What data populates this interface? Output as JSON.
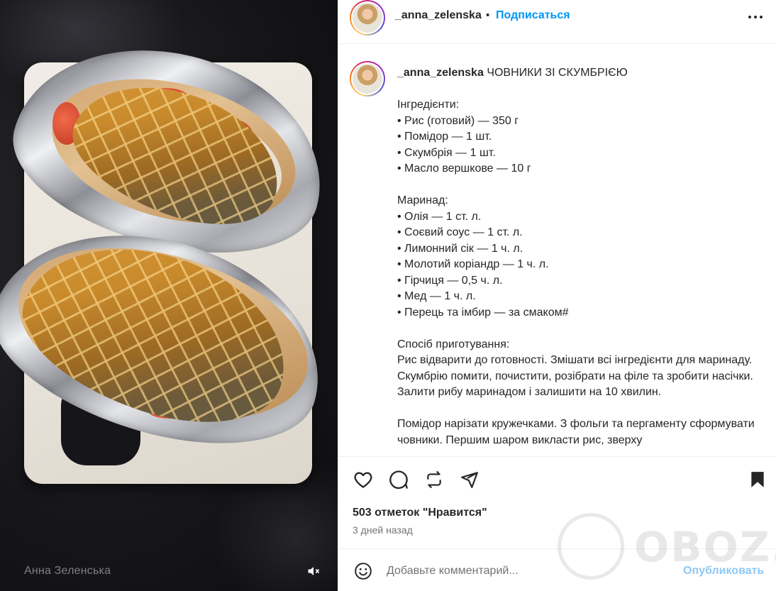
{
  "media": {
    "watermark_name": "Анна Зеленська",
    "mute_icon": "speaker-muted-icon"
  },
  "header": {
    "username": "_anna_zelenska",
    "separator": "•",
    "follow_label": "Подписаться",
    "more_icon": "more-horizontal-icon"
  },
  "caption": {
    "author": "_anna_zelenska",
    "title": "ЧОВНИКИ ЗІ СКУМБРІЄЮ",
    "ingredients_heading": "Інгредієнти:",
    "ingredients": [
      "• Рис (готовий) — 350 г",
      "• Помідор — 1 шт.",
      "• Скумбрія — 1 шт.",
      "• Масло вершкове — 10 г"
    ],
    "marinade_heading": "Маринад:",
    "marinade": [
      "• Олія — 1 ст. л.",
      "• Соєвий соус — 1 ст. л.",
      "• Лимонний сік — 1 ч. л.",
      "• Молотий коріандр — 1 ч. л.",
      "• Гірчиця — 0,5 ч. л.",
      "• Мед — 1 ч. л.",
      "• Перець та імбир — за смаком#"
    ],
    "method_heading": "Спосіб приготування:",
    "method_p1": "Рис відварити до готовності. Змішати всі інгредієнти для маринаду. Скумбрію помити, почистити, розібрати на філе та зробити насічки. Залити рибу маринадом і залишити на 10 хвилин.",
    "method_p2": "Помідор нарізати кружечками. З фольги та пергаменту сформувати човники. Першим шаром викласти рис, зверху"
  },
  "actions": {
    "like_icon": "heart-icon",
    "comment_icon": "comment-icon",
    "repost_icon": "repost-icon",
    "share_icon": "send-icon",
    "save_icon": "bookmark-icon"
  },
  "likes_text": "503 отметок \"Нравится\"",
  "date_text": "3 дней назад",
  "comment": {
    "placeholder": "Добавьте комментарий...",
    "post_label": "Опубликовать",
    "emoji_icon": "emoji-icon"
  },
  "watermark": {
    "text": "OBOZ.UA"
  },
  "colors": {
    "accent": "#0095f6",
    "post_disabled": "#8ec8f4",
    "text": "#262626",
    "muted": "#737373"
  }
}
